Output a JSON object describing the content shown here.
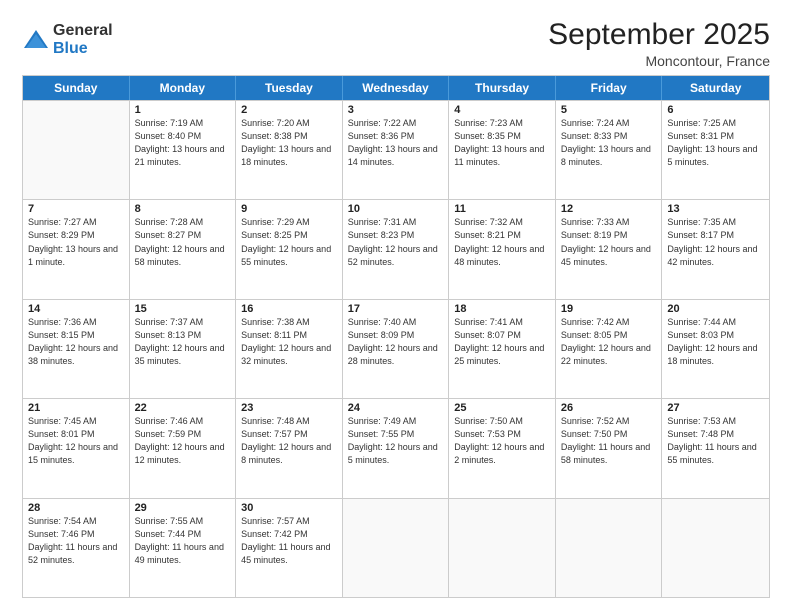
{
  "logo": {
    "general": "General",
    "blue": "Blue"
  },
  "title": "September 2025",
  "subtitle": "Moncontour, France",
  "days": [
    "Sunday",
    "Monday",
    "Tuesday",
    "Wednesday",
    "Thursday",
    "Friday",
    "Saturday"
  ],
  "weeks": [
    [
      {
        "date": "",
        "sunrise": "",
        "sunset": "",
        "daylight": ""
      },
      {
        "date": "1",
        "sunrise": "Sunrise: 7:19 AM",
        "sunset": "Sunset: 8:40 PM",
        "daylight": "Daylight: 13 hours and 21 minutes."
      },
      {
        "date": "2",
        "sunrise": "Sunrise: 7:20 AM",
        "sunset": "Sunset: 8:38 PM",
        "daylight": "Daylight: 13 hours and 18 minutes."
      },
      {
        "date": "3",
        "sunrise": "Sunrise: 7:22 AM",
        "sunset": "Sunset: 8:36 PM",
        "daylight": "Daylight: 13 hours and 14 minutes."
      },
      {
        "date": "4",
        "sunrise": "Sunrise: 7:23 AM",
        "sunset": "Sunset: 8:35 PM",
        "daylight": "Daylight: 13 hours and 11 minutes."
      },
      {
        "date": "5",
        "sunrise": "Sunrise: 7:24 AM",
        "sunset": "Sunset: 8:33 PM",
        "daylight": "Daylight: 13 hours and 8 minutes."
      },
      {
        "date": "6",
        "sunrise": "Sunrise: 7:25 AM",
        "sunset": "Sunset: 8:31 PM",
        "daylight": "Daylight: 13 hours and 5 minutes."
      }
    ],
    [
      {
        "date": "7",
        "sunrise": "Sunrise: 7:27 AM",
        "sunset": "Sunset: 8:29 PM",
        "daylight": "Daylight: 13 hours and 1 minute."
      },
      {
        "date": "8",
        "sunrise": "Sunrise: 7:28 AM",
        "sunset": "Sunset: 8:27 PM",
        "daylight": "Daylight: 12 hours and 58 minutes."
      },
      {
        "date": "9",
        "sunrise": "Sunrise: 7:29 AM",
        "sunset": "Sunset: 8:25 PM",
        "daylight": "Daylight: 12 hours and 55 minutes."
      },
      {
        "date": "10",
        "sunrise": "Sunrise: 7:31 AM",
        "sunset": "Sunset: 8:23 PM",
        "daylight": "Daylight: 12 hours and 52 minutes."
      },
      {
        "date": "11",
        "sunrise": "Sunrise: 7:32 AM",
        "sunset": "Sunset: 8:21 PM",
        "daylight": "Daylight: 12 hours and 48 minutes."
      },
      {
        "date": "12",
        "sunrise": "Sunrise: 7:33 AM",
        "sunset": "Sunset: 8:19 PM",
        "daylight": "Daylight: 12 hours and 45 minutes."
      },
      {
        "date": "13",
        "sunrise": "Sunrise: 7:35 AM",
        "sunset": "Sunset: 8:17 PM",
        "daylight": "Daylight: 12 hours and 42 minutes."
      }
    ],
    [
      {
        "date": "14",
        "sunrise": "Sunrise: 7:36 AM",
        "sunset": "Sunset: 8:15 PM",
        "daylight": "Daylight: 12 hours and 38 minutes."
      },
      {
        "date": "15",
        "sunrise": "Sunrise: 7:37 AM",
        "sunset": "Sunset: 8:13 PM",
        "daylight": "Daylight: 12 hours and 35 minutes."
      },
      {
        "date": "16",
        "sunrise": "Sunrise: 7:38 AM",
        "sunset": "Sunset: 8:11 PM",
        "daylight": "Daylight: 12 hours and 32 minutes."
      },
      {
        "date": "17",
        "sunrise": "Sunrise: 7:40 AM",
        "sunset": "Sunset: 8:09 PM",
        "daylight": "Daylight: 12 hours and 28 minutes."
      },
      {
        "date": "18",
        "sunrise": "Sunrise: 7:41 AM",
        "sunset": "Sunset: 8:07 PM",
        "daylight": "Daylight: 12 hours and 25 minutes."
      },
      {
        "date": "19",
        "sunrise": "Sunrise: 7:42 AM",
        "sunset": "Sunset: 8:05 PM",
        "daylight": "Daylight: 12 hours and 22 minutes."
      },
      {
        "date": "20",
        "sunrise": "Sunrise: 7:44 AM",
        "sunset": "Sunset: 8:03 PM",
        "daylight": "Daylight: 12 hours and 18 minutes."
      }
    ],
    [
      {
        "date": "21",
        "sunrise": "Sunrise: 7:45 AM",
        "sunset": "Sunset: 8:01 PM",
        "daylight": "Daylight: 12 hours and 15 minutes."
      },
      {
        "date": "22",
        "sunrise": "Sunrise: 7:46 AM",
        "sunset": "Sunset: 7:59 PM",
        "daylight": "Daylight: 12 hours and 12 minutes."
      },
      {
        "date": "23",
        "sunrise": "Sunrise: 7:48 AM",
        "sunset": "Sunset: 7:57 PM",
        "daylight": "Daylight: 12 hours and 8 minutes."
      },
      {
        "date": "24",
        "sunrise": "Sunrise: 7:49 AM",
        "sunset": "Sunset: 7:55 PM",
        "daylight": "Daylight: 12 hours and 5 minutes."
      },
      {
        "date": "25",
        "sunrise": "Sunrise: 7:50 AM",
        "sunset": "Sunset: 7:53 PM",
        "daylight": "Daylight: 12 hours and 2 minutes."
      },
      {
        "date": "26",
        "sunrise": "Sunrise: 7:52 AM",
        "sunset": "Sunset: 7:50 PM",
        "daylight": "Daylight: 11 hours and 58 minutes."
      },
      {
        "date": "27",
        "sunrise": "Sunrise: 7:53 AM",
        "sunset": "Sunset: 7:48 PM",
        "daylight": "Daylight: 11 hours and 55 minutes."
      }
    ],
    [
      {
        "date": "28",
        "sunrise": "Sunrise: 7:54 AM",
        "sunset": "Sunset: 7:46 PM",
        "daylight": "Daylight: 11 hours and 52 minutes."
      },
      {
        "date": "29",
        "sunrise": "Sunrise: 7:55 AM",
        "sunset": "Sunset: 7:44 PM",
        "daylight": "Daylight: 11 hours and 49 minutes."
      },
      {
        "date": "30",
        "sunrise": "Sunrise: 7:57 AM",
        "sunset": "Sunset: 7:42 PM",
        "daylight": "Daylight: 11 hours and 45 minutes."
      },
      {
        "date": "",
        "sunrise": "",
        "sunset": "",
        "daylight": ""
      },
      {
        "date": "",
        "sunrise": "",
        "sunset": "",
        "daylight": ""
      },
      {
        "date": "",
        "sunrise": "",
        "sunset": "",
        "daylight": ""
      },
      {
        "date": "",
        "sunrise": "",
        "sunset": "",
        "daylight": ""
      }
    ]
  ]
}
